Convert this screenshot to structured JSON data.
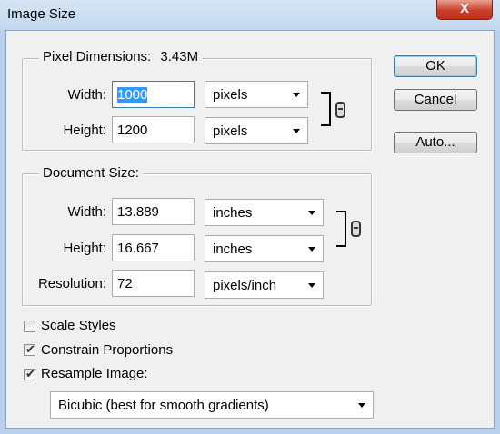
{
  "window": {
    "title": "Image Size",
    "close_glyph": "X"
  },
  "pixel_dimensions": {
    "legend": "Pixel Dimensions:",
    "size": "3.43M",
    "width": {
      "label": "Width:",
      "value": "1000",
      "unit": "pixels"
    },
    "height": {
      "label": "Height:",
      "value": "1200",
      "unit": "pixels"
    }
  },
  "document_size": {
    "legend": "Document Size:",
    "width": {
      "label": "Width:",
      "value": "13.889",
      "unit": "inches"
    },
    "height": {
      "label": "Height:",
      "value": "16.667",
      "unit": "inches"
    },
    "resolution": {
      "label": "Resolution:",
      "value": "72",
      "unit": "pixels/inch"
    }
  },
  "buttons": {
    "ok": "OK",
    "cancel": "Cancel",
    "auto": "Auto..."
  },
  "options": {
    "scale_styles": {
      "label": "Scale Styles",
      "checked": false
    },
    "constrain_proportions": {
      "label": "Constrain Proportions",
      "checked": true
    },
    "resample_image": {
      "label": "Resample Image:",
      "checked": true
    },
    "resample_method": "Bicubic (best for smooth gradients)"
  },
  "icons": {
    "link": "chain-link-icon",
    "dropdown": "chevron-down-icon",
    "check": "checkmark-icon"
  }
}
